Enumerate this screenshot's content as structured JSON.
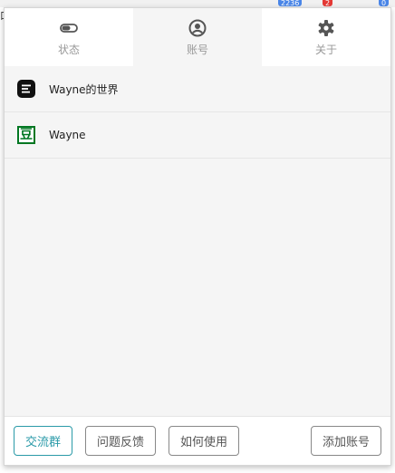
{
  "browser_badges": [
    {
      "text": "2236",
      "color": "#4a86e8"
    },
    {
      "text": "2",
      "color": "#e53935"
    },
    {
      "text": "0",
      "color": "#4a86e8"
    }
  ],
  "tabs": [
    {
      "label": "状态",
      "icon": "toggle-icon",
      "active": false
    },
    {
      "label": "账号",
      "icon": "account-circle-icon",
      "active": true
    },
    {
      "label": "关于",
      "icon": "gear-icon",
      "active": false
    }
  ],
  "accounts": [
    {
      "name": "Wayne的世界",
      "icon": "wayne-world-logo-icon",
      "icon_color": "#111111"
    },
    {
      "name": "Wayne",
      "icon": "douban-logo-icon",
      "icon_color": "#007722",
      "icon_glyph": "豆"
    }
  ],
  "footer": {
    "group_label": "交流群",
    "feedback_label": "问题反馈",
    "howto_label": "如何使用",
    "add_account_label": "添加账号"
  },
  "colors": {
    "accent": "#2a9aa8",
    "douban_green": "#007722"
  }
}
